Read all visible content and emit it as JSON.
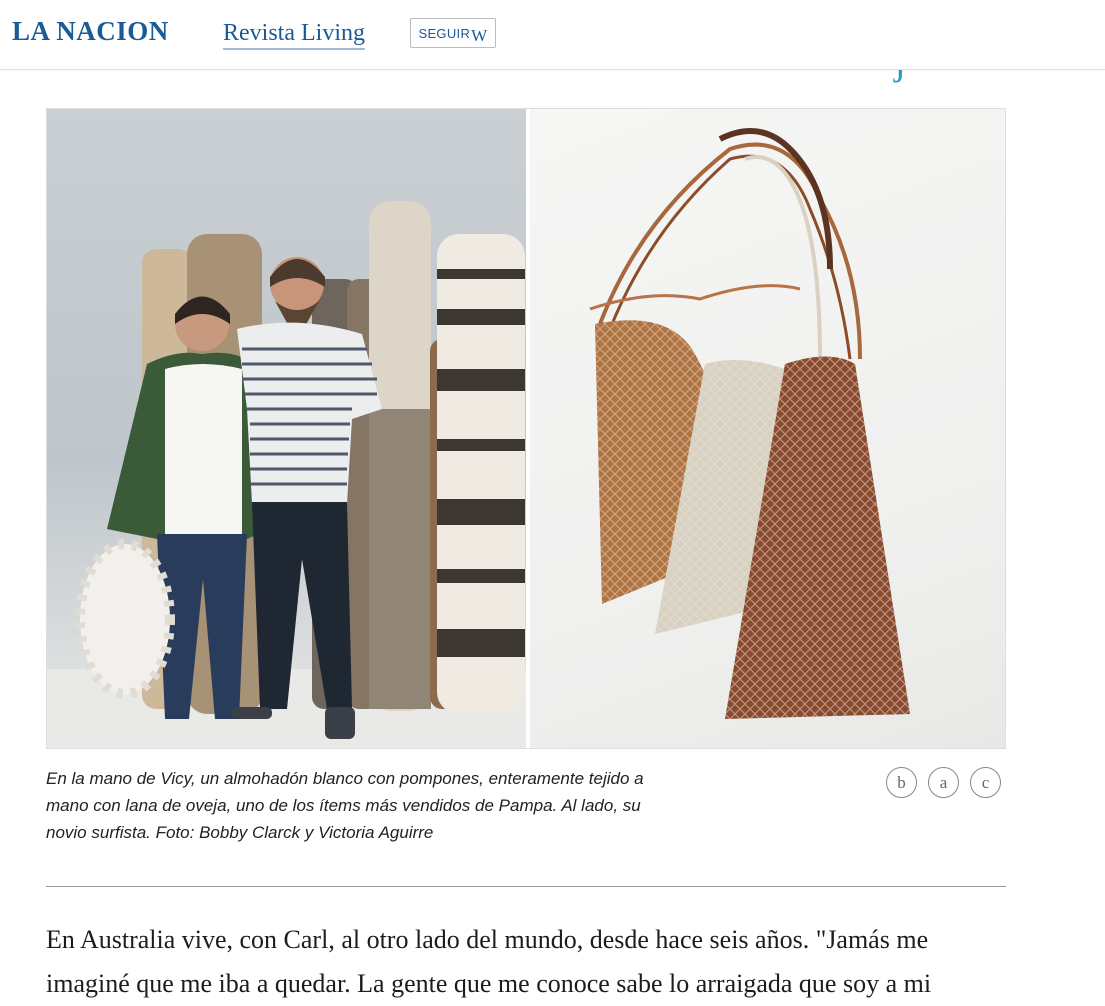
{
  "header": {
    "logo": "LA NACION",
    "section": "Revista Living",
    "follow_label": "SEGUIR",
    "follow_icon": "W",
    "cut_text": "g"
  },
  "article": {
    "photo": {
      "left_description_icon": "people-with-rugs-photo",
      "right_description_icon": "woven-bags-photo",
      "badge_letter": "j"
    },
    "caption": "En la mano de Vicy, un almohadón blanco con pompones, enteramente tejido a mano con lana de oveja, uno de los ítems más vendidos de Pampa. Al lado, su novio surfista. Foto: Bobby Clarck y Victoria Aguirre",
    "gallery_nav": [
      "b",
      "a",
      "c"
    ],
    "body_line_1": "En Australia vive, con Carl, al otro lado del mundo, desde hace seis años. \"Jamás me",
    "body_line_2": "imaginé que me iba a quedar. La gente que me conoce sabe lo arraigada que soy a mi"
  },
  "colors": {
    "brand_blue": "#1a5a96",
    "badge_blue": "#2c9bc7"
  }
}
